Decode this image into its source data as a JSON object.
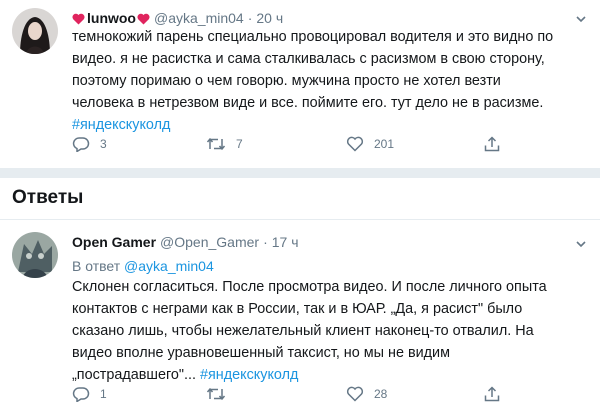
{
  "tweet1": {
    "name": "lunwoo",
    "handle": "@ayka_min04",
    "time": "20 ч",
    "lines": [
      "темнокожий парень специально провоцировал водителя и это видно по",
      "видео. я не расистка и сама сталкивалась с расизмом в свою сторону,",
      "поэтому поримаю о чем говорю. мужчина просто не хотел везти",
      "человека в нетрезвом виде и все. поймите его. тут дело не в расизме."
    ],
    "hashtag": "#яндекскуколд",
    "replies": "3",
    "retweets": "7",
    "likes": "201"
  },
  "section_title": "Ответы",
  "tweet2": {
    "name": "Open Gamer",
    "handle": "@Open_Gamer",
    "time": "17 ч",
    "replying_prefix": "В ответ",
    "replying_to": "@ayka_min04",
    "lines": [
      "Склонен согласиться. После просмотра видео. И после личного опыта",
      "контактов с неграми как в России, так и в ЮАР. „Да, я расист\" было",
      "сказано лишь, чтобы нежелательный клиент наконец-то отвалил. На",
      "видео вполне уравновешенный таксист, но мы не видим"
    ],
    "last_line_text": "„пострадавшего\"...",
    "hashtag": "#яндекскуколд",
    "replies": "1",
    "retweets": "",
    "likes": "28"
  },
  "colors": {
    "text": "#14171a",
    "secondary": "#657786",
    "link": "#1b95e0",
    "heart": "#e0245e"
  },
  "icons": [
    "reply-icon",
    "retweet-icon",
    "like-icon",
    "share-icon",
    "caret-down-icon",
    "heart-emoji-icon"
  ]
}
